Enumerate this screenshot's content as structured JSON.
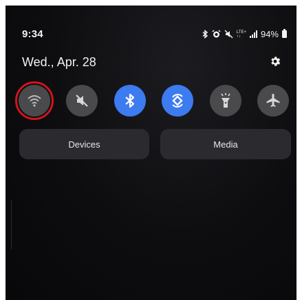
{
  "status_bar": {
    "time": "9:34",
    "network": "LTE+",
    "battery": "94%",
    "icons": [
      "bluetooth-icon",
      "alarm-icon",
      "mute-icon",
      "lte-icon",
      "signal-icon",
      "battery-icon"
    ]
  },
  "header": {
    "date": "Wed., Apr. 28",
    "settings_icon": "gear-icon"
  },
  "quick_tiles": [
    {
      "name": "wifi",
      "icon": "wifi-icon",
      "state": "off",
      "highlighted": true
    },
    {
      "name": "sound",
      "icon": "mute-icon",
      "state": "off"
    },
    {
      "name": "bluetooth",
      "icon": "bluetooth-icon",
      "state": "on"
    },
    {
      "name": "auto-rotate",
      "icon": "rotate-icon",
      "state": "on"
    },
    {
      "name": "flashlight",
      "icon": "flashlight-icon",
      "state": "off"
    },
    {
      "name": "airplane-mode",
      "icon": "airplane-icon",
      "state": "off"
    }
  ],
  "buttons": {
    "devices_label": "Devices",
    "media_label": "Media"
  },
  "colors": {
    "accent_on": "#3c7bf0",
    "tile_off": "#4a4a4d",
    "highlight": "#d0141a",
    "panel_bg": "#0d0d10"
  }
}
